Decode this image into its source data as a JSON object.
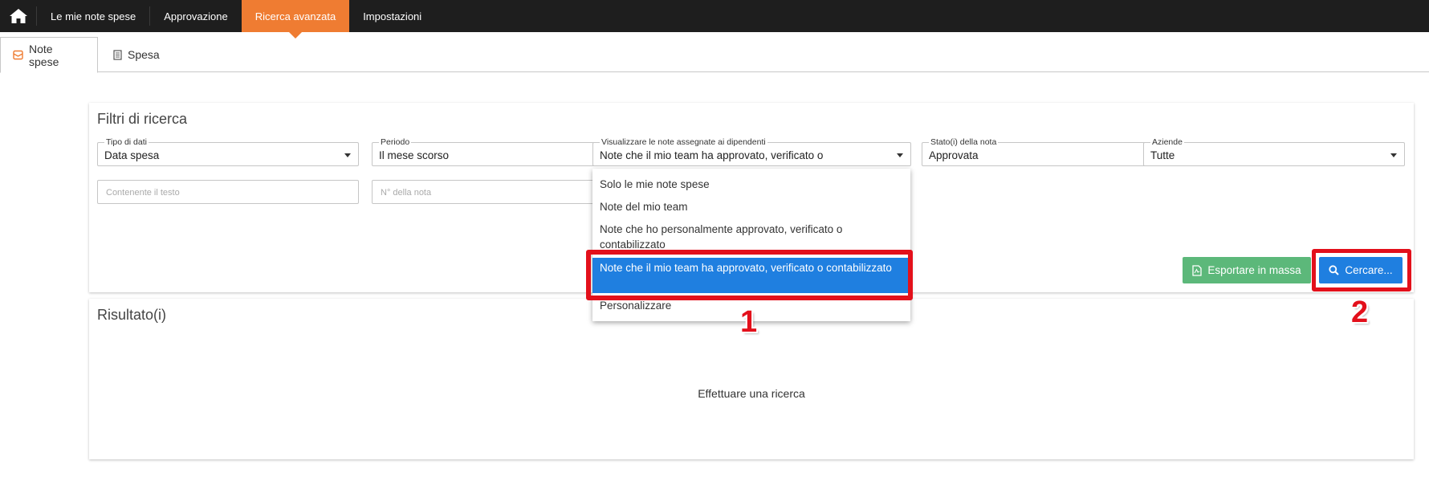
{
  "nav": {
    "items": [
      {
        "label": "Le mie note spese"
      },
      {
        "label": "Approvazione"
      },
      {
        "label": "Ricerca avanzata"
      },
      {
        "label": "Impostazioni"
      }
    ]
  },
  "tabs": {
    "note_spese": "Note spese",
    "spesa": "Spesa"
  },
  "filters": {
    "title": "Filtri di ricerca",
    "tipo_dati": {
      "label": "Tipo di dati",
      "value": "Data spesa"
    },
    "periodo": {
      "label": "Periodo",
      "value": "Il mese scorso"
    },
    "visualizzare": {
      "label": "Visualizzare le note assegnate ai dipendenti",
      "value": "Note che il mio team ha approvato, verificato o"
    },
    "stato": {
      "label": "Stato(i) della nota",
      "value": "Approvata"
    },
    "aziende": {
      "label": "Aziende",
      "value": "Tutte"
    },
    "testo_placeholder": "Contenente il testo",
    "numero_placeholder": "N° della nota",
    "export_label": "Esportare in massa",
    "search_label": "Cercare..."
  },
  "dropdown": {
    "options": [
      "Solo le mie note spese",
      "Note del mio team",
      "Note che ho personalmente approvato, verificato o contabilizzato",
      "Note che il mio team ha approvato, verificato o contabilizzato",
      "Personalizzare"
    ],
    "selected_index": 3
  },
  "results": {
    "title": "Risultato(i)",
    "empty_message": "Effettuare una ricerca"
  },
  "callouts": {
    "one": "1",
    "two": "2"
  },
  "colors": {
    "nav_bg": "#1e1e1e",
    "nav_active": "#ef7c32",
    "primary": "#1f7fe0",
    "success": "#5cb87a",
    "highlight": "#e3101b"
  }
}
